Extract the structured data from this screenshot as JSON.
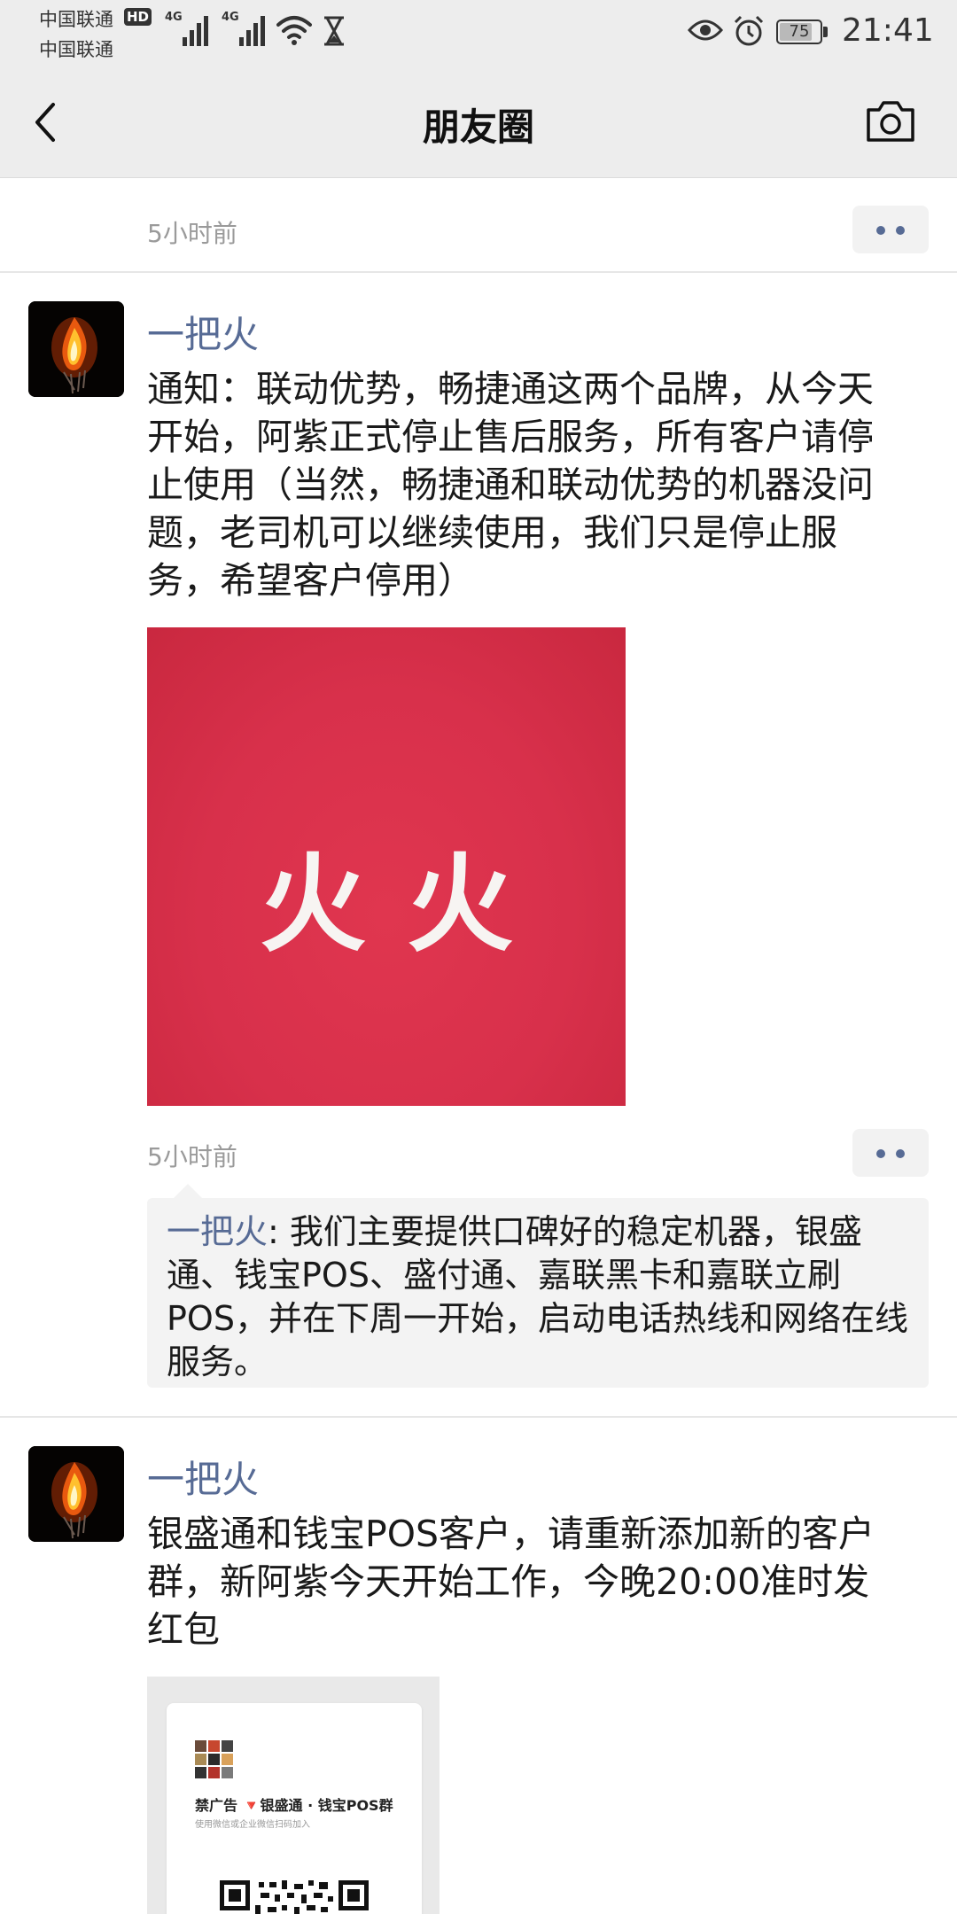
{
  "status_bar": {
    "carrier_1": "中国联通",
    "carrier_2": "中国联通",
    "hd_badge": "HD",
    "network_1": "4G",
    "network_2": "4G",
    "battery": "75",
    "time": "21:41"
  },
  "header": {
    "title": "朋友圈"
  },
  "posts": [
    {
      "time": "5小时前"
    },
    {
      "author": "一把火",
      "content": "通知：联动优势，畅捷通这两个品牌，从今天开始，阿紫正式停止售后服务，所有客户请停止使用（当然，畅捷通和联动优势的机器没问题，老司机可以继续使用，我们只是停止服务，希望客户停用）",
      "image_text": "火火",
      "time": "5小时前",
      "comment": {
        "author": "一把火",
        "text": ": 我们主要提供口碑好的稳定机器，银盛通、钱宝POS、盛付通、嘉联黑卡和嘉联立刷POS，并在下周一开始，启动电话热线和网络在线服务。"
      }
    },
    {
      "author": "一把火",
      "content": "银盛通和钱宝POS客户，请重新添加新的客户群，新阿紫今天开始工作，今晚20:00准时发红包",
      "poster": {
        "title": "禁广告 🔻银盛通 · 钱宝POS群",
        "subtitle": "使用微信或企业微信扫码加入"
      }
    }
  ],
  "colors": {
    "accent_name": "#576b95",
    "header_bg": "#ededed",
    "image_red": "#d8304b"
  },
  "icons": [
    "back-arrow-icon",
    "camera-icon",
    "more-dots-icon",
    "wifi-icon",
    "signal-icon",
    "eye-icon",
    "alarm-icon",
    "hourglass-icon",
    "battery-icon"
  ]
}
